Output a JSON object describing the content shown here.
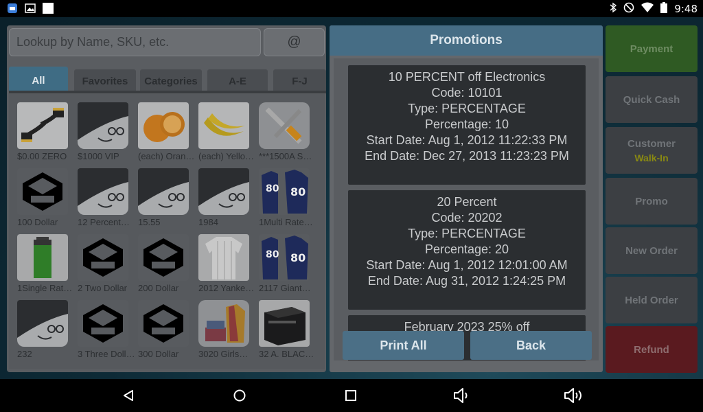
{
  "status_bar": {
    "time": "9:48",
    "left_icons": [
      "app-notification-icon",
      "image-notification-icon",
      "blank-notification-icon"
    ],
    "right_icons": [
      "bluetooth-icon",
      "do-not-disturb-icon",
      "wifi-icon",
      "battery-icon"
    ]
  },
  "left_panel": {
    "search": {
      "placeholder": "Lookup by Name, SKU, etc."
    },
    "at_button": "@",
    "tabs": [
      {
        "label": "All",
        "active": true
      },
      {
        "label": "Favorites",
        "active": false
      },
      {
        "label": "Categories",
        "active": false
      },
      {
        "label": "A-E",
        "active": false
      },
      {
        "label": "F-J",
        "active": false
      }
    ],
    "items": [
      {
        "label": "$0.00 ZERO",
        "icon": "hdmi-cable-icon"
      },
      {
        "label": "$1000 VIP",
        "icon": "placeholder-face-icon"
      },
      {
        "label": "(each) Oran…",
        "icon": "orange-icon"
      },
      {
        "label": "(each) Yello…",
        "icon": "banana-icon"
      },
      {
        "label": "***1500A S…",
        "icon": "tools-icon"
      },
      {
        "label": "100 Dollar",
        "icon": "box-logo-icon"
      },
      {
        "label": "12 Percent…",
        "icon": "placeholder-face-icon"
      },
      {
        "label": "15.55",
        "icon": "placeholder-face-icon"
      },
      {
        "label": "1984",
        "icon": "placeholder-face-icon"
      },
      {
        "label": "1Multi Rate…",
        "icon": "jersey-icon"
      },
      {
        "label": "1Single Rat…",
        "icon": "battery-product-icon"
      },
      {
        "label": "2 Two Dollar",
        "icon": "box-logo-icon"
      },
      {
        "label": "200 Dollar",
        "icon": "box-logo-icon"
      },
      {
        "label": "2012 Yanke…",
        "icon": "baseball-jersey-icon"
      },
      {
        "label": "2117 Giant…",
        "icon": "jersey-icon"
      },
      {
        "label": "232",
        "icon": "placeholder-face-icon"
      },
      {
        "label": "3 Three Doll…",
        "icon": "box-logo-icon"
      },
      {
        "label": "300 Dollar",
        "icon": "box-logo-icon"
      },
      {
        "label": "3020 Girls…",
        "icon": "clothes-icon"
      },
      {
        "label": "32 A. BLAC…",
        "icon": "battery-box-icon"
      }
    ]
  },
  "promotions": {
    "title": "Promotions",
    "cards": [
      {
        "lines": [
          "10 PERCENT off Electronics",
          "Code: 10101",
          "Type: PERCENTAGE",
          "Percentage: 10",
          "Start Date: Aug 1, 2012 11:22:33 PM",
          "End Date: Dec 27, 2013 11:23:23 PM"
        ]
      },
      {
        "lines": [
          "20 Percent",
          "Code: 20202",
          "Type: PERCENTAGE",
          "Percentage: 20",
          "Start Date: Aug 1, 2012 12:01:00 AM",
          "End Date: Aug 31, 2012 1:24:25 PM"
        ]
      },
      {
        "lines": [
          "February 2023 25% off"
        ]
      }
    ],
    "print_all_label": "Print All",
    "back_label": "Back"
  },
  "right_panel": {
    "payment": "Payment",
    "quick_cash": "Quick Cash",
    "customer": "Customer",
    "customer_value": "Walk-In",
    "promo": "Promo",
    "new_order": "New Order",
    "held_order": "Held Order",
    "refund": "Refund"
  },
  "nav_bar": {
    "icons": [
      "back-icon",
      "home-icon",
      "recents-icon",
      "volume-down-icon",
      "volume-up-icon"
    ]
  },
  "colors": {
    "header_blue": "#466d85",
    "payment_green": "#2f5a23",
    "refund_red": "#5a1a1f",
    "walk_in_yellow": "#8a8a12"
  }
}
